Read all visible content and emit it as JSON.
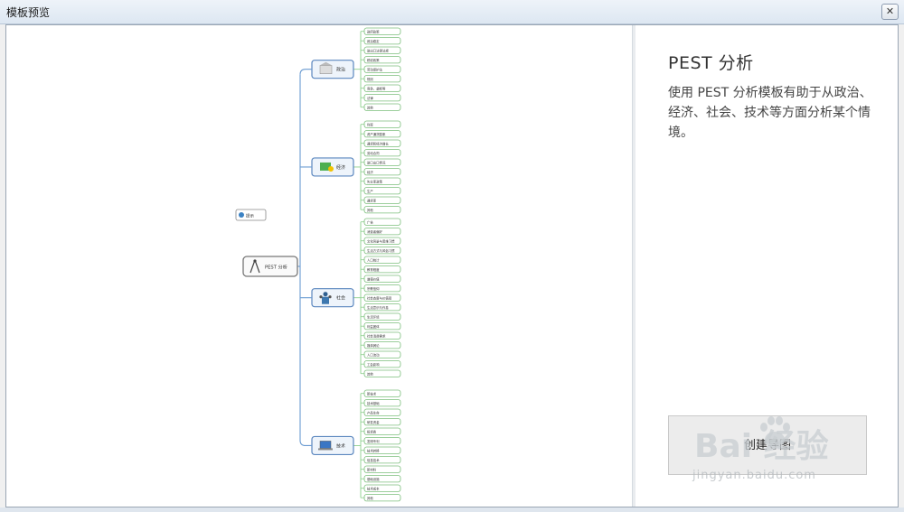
{
  "window": {
    "title": "模板预览",
    "close_label": "✕"
  },
  "mindmap": {
    "root": "PEST 分析",
    "note": "提示",
    "branches": [
      {
        "label": "政治",
        "icon": "government-building-icon",
        "items": [
          "政府政策",
          "政治稳定",
          "进出口法律法规",
          "税收政策",
          "劳动保护法",
          "规则",
          "竞争、垄断等",
          "法律",
          "其他"
        ]
      },
      {
        "label": "经济",
        "icon": "money-icon",
        "items": [
          "利率",
          "资产通货膨胀",
          "通货和经济增长",
          "劳动合同",
          "进口出口情况",
          "经济",
          "失业率政策",
          "生产",
          "通货率",
          "其他"
        ]
      },
      {
        "label": "社会",
        "icon": "people-icon",
        "items": [
          "广告",
          "消费者偏好",
          "文化背景与思维习惯",
          "生活方式与风俗习惯",
          "人口统计",
          "教育程度",
          "道德价值",
          "宗教信仰",
          "社会态度与价值观",
          "生活意识与作息",
          "生活环境",
          "利益团体",
          "社会消费需求",
          "媒体舆论",
          "人口流动",
          "工会影响",
          "其他"
        ]
      },
      {
        "label": "技术",
        "icon": "computer-icon",
        "items": [
          "新技术",
          "技术基础",
          "产品生命",
          "研发资金",
          "投资费",
          "发明专利",
          "技术转移",
          "信息技术",
          "新材料",
          "基础设施",
          "技术成本",
          "其他"
        ]
      }
    ]
  },
  "info": {
    "title": "PEST 分析",
    "description": "使用 PEST 分析模板有助于从政治、经济、社会、技术等方面分析某个情境。",
    "create_button": "创建导图"
  },
  "watermark": {
    "logo": "Bai   经验",
    "url": "jingyan.baidu.com"
  },
  "colors": {
    "accent": "#5b87bf",
    "leaf_border": "#7cbf7c",
    "line": "#6a9bd1",
    "leaf_line": "#8ccf8c"
  }
}
